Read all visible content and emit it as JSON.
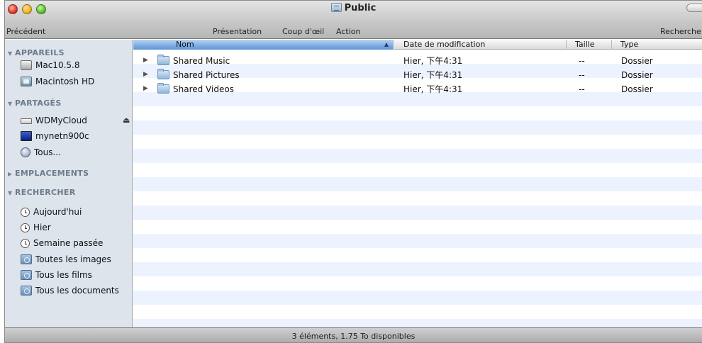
{
  "window": {
    "title": "Public"
  },
  "toolbar": {
    "back_label": "Précédent",
    "view_label": "Présentation",
    "quicklook_label": "Coup d'œil",
    "action_label": "Action",
    "search_label": "Recherche"
  },
  "sidebar": {
    "sections": [
      {
        "title": "APPAREILS",
        "expanded": true
      },
      {
        "title": "PARTAGÉS",
        "expanded": true
      },
      {
        "title": "EMPLACEMENTS",
        "expanded": false
      },
      {
        "title": "RECHERCHER",
        "expanded": true
      }
    ],
    "devices": [
      {
        "label": "Mac10.5.8",
        "icon": "disk-icon"
      },
      {
        "label": "Macintosh HD",
        "icon": "hard-drive-icon"
      }
    ],
    "shared": [
      {
        "label": "WDMyCloud",
        "icon": "network-drive-icon",
        "ejectable": true
      },
      {
        "label": "mynetn900c",
        "icon": "computer-screen-icon"
      },
      {
        "label": "Tous...",
        "icon": "globe-icon"
      }
    ],
    "searches": [
      {
        "label": "Aujourd'hui",
        "icon": "clock-icon"
      },
      {
        "label": "Hier",
        "icon": "clock-icon"
      },
      {
        "label": "Semaine passée",
        "icon": "clock-icon"
      },
      {
        "label": "Toutes les images",
        "icon": "smart-folder-icon"
      },
      {
        "label": "Tous les films",
        "icon": "smart-folder-icon"
      },
      {
        "label": "Tous les documents",
        "icon": "smart-folder-icon"
      }
    ]
  },
  "list": {
    "columns": {
      "name": "Nom",
      "date": "Date de modification",
      "size": "Taille",
      "kind": "Type"
    },
    "sorted_column": "Nom",
    "rows": [
      {
        "name": "Shared Music",
        "date": "Hier, 下午4:31",
        "size": "--",
        "kind": "Dossier"
      },
      {
        "name": "Shared Pictures",
        "date": "Hier, 下午4:31",
        "size": "--",
        "kind": "Dossier"
      },
      {
        "name": "Shared Videos",
        "date": "Hier, 下午4:31",
        "size": "--",
        "kind": "Dossier"
      }
    ]
  },
  "status": {
    "text": "3 éléments, 1.75 To disponibles"
  },
  "colors": {
    "sidebar_bg": "#dde4ec",
    "stripe": "#edf3fe",
    "sorted_header": "#5b93d6"
  }
}
